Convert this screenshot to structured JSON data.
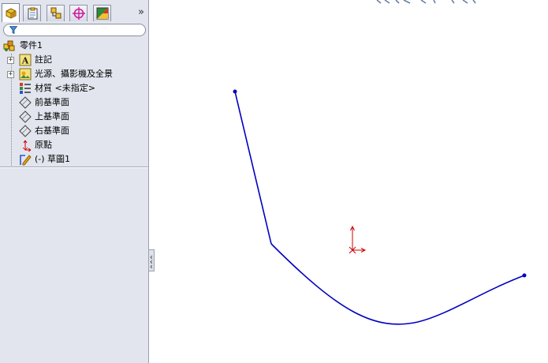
{
  "panel": {
    "tabs": [
      {
        "icon": "feature-manager-icon",
        "active": true
      },
      {
        "icon": "property-manager-icon",
        "active": false
      },
      {
        "icon": "configuration-manager-icon",
        "active": false
      },
      {
        "icon": "dimxpert-manager-icon",
        "active": false
      },
      {
        "icon": "display-manager-icon",
        "active": false
      }
    ],
    "expand_glyph": "»",
    "filter_icon": "filter-icon",
    "tree": [
      {
        "label": "零件1",
        "icon": "part-icon",
        "expandable": false,
        "expander": ""
      },
      {
        "label": "註記",
        "icon": "annotations-icon",
        "expandable": true,
        "expander": "+"
      },
      {
        "label": "光源、攝影機及全景",
        "icon": "lights-cameras-scene-icon",
        "expandable": true,
        "expander": "+"
      },
      {
        "label": "材質 <未指定>",
        "icon": "material-icon",
        "expandable": false,
        "expander": ""
      },
      {
        "label": "前基準面",
        "icon": "plane-icon",
        "expandable": false,
        "expander": ""
      },
      {
        "label": "上基準面",
        "icon": "plane-icon",
        "expandable": false,
        "expander": ""
      },
      {
        "label": "右基準面",
        "icon": "plane-icon",
        "expandable": false,
        "expander": ""
      },
      {
        "label": "原點",
        "icon": "origin-icon",
        "expandable": false,
        "expander": ""
      },
      {
        "label": "(-) 草圖1",
        "icon": "sketch-icon",
        "expandable": false,
        "expander": ""
      }
    ]
  },
  "graphics": {
    "sketch_color": "#0000c0",
    "origin_color": "#cc0000",
    "sketch_entities": [
      "line",
      "arc"
    ],
    "origin_icon": "sketch-origin-icon"
  }
}
